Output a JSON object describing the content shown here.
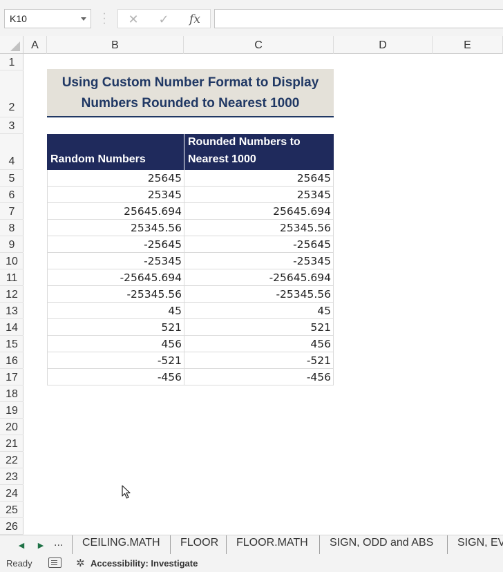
{
  "formula_bar": {
    "name_box": "K10",
    "cancel_icon": "✕",
    "enter_icon": "✓",
    "fx_label": "fx",
    "formula": ""
  },
  "columns": [
    "A",
    "B",
    "C",
    "D",
    "E"
  ],
  "rows": [
    "1",
    "2",
    "3",
    "4",
    "5",
    "6",
    "7",
    "8",
    "9",
    "10",
    "11",
    "12",
    "13",
    "14",
    "15",
    "16",
    "17",
    "18",
    "19",
    "20",
    "21",
    "22",
    "23",
    "24",
    "25",
    "26"
  ],
  "sheet": {
    "title": "Using Custom Number Format to Display\nNumbers Rounded to Nearest 1000",
    "header_b": "Random Numbers",
    "header_c_line1": "Rounded Numbers to",
    "header_c_line2": "Nearest 1000",
    "data": [
      [
        "25645",
        "25645"
      ],
      [
        "25345",
        "25345"
      ],
      [
        "25645.694",
        "25645.694"
      ],
      [
        "25345.56",
        "25345.56"
      ],
      [
        "-25645",
        "-25645"
      ],
      [
        "-25345",
        "-25345"
      ],
      [
        "-25645.694",
        "-25645.694"
      ],
      [
        "-25345.56",
        "-25345.56"
      ],
      [
        "45",
        "45"
      ],
      [
        "521",
        "521"
      ],
      [
        "456",
        "456"
      ],
      [
        "-521",
        "-521"
      ],
      [
        "-456",
        "-456"
      ]
    ]
  },
  "tabs": {
    "more": "...",
    "items": [
      "CEILING.MATH",
      "FLOOR",
      "FLOOR.MATH",
      "SIGN, ODD and ABS",
      "SIGN, EV"
    ]
  },
  "status": {
    "ready": "Ready",
    "accessibility": "Accessibility: Investigate"
  },
  "icons": [
    "chevron-down-icon",
    "cancel-icon",
    "enter-icon",
    "fx-icon",
    "select-all-icon",
    "tab-prev-icon",
    "tab-next-icon",
    "macro-record-icon",
    "accessibility-icon",
    "mouse-pointer-icon"
  ],
  "colors": {
    "title_bg": "#e4e1d9",
    "title_text": "#203864",
    "header_bg": "#1f2a5c",
    "nav_green": "#1e7145"
  }
}
